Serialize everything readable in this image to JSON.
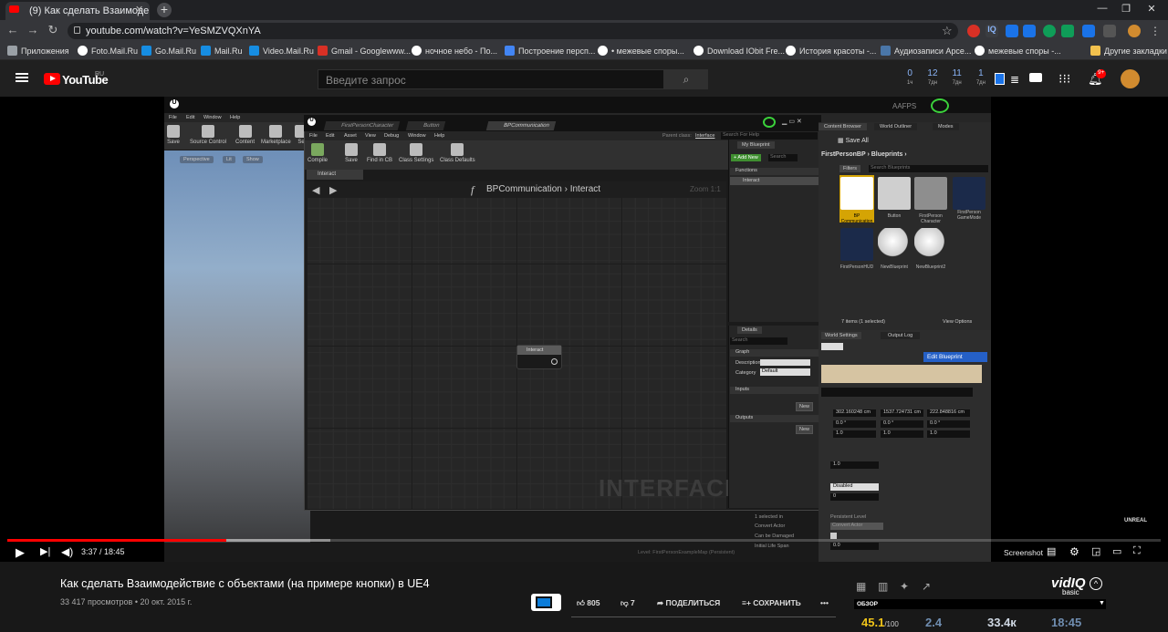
{
  "browser": {
    "tab_title": "(9) Как сделать Взаимодействие",
    "new_tab": "+",
    "url": "youtube.com/watch?v=YeSMZVQXnYA",
    "window_controls": [
      "—",
      "❐",
      "✕"
    ]
  },
  "bookmarks": [
    {
      "label": "Приложения",
      "color": "#9aa0a6"
    },
    {
      "label": "Foto.Mail.Ru",
      "color": "#ffffff"
    },
    {
      "label": "Go.Mail.Ru",
      "color": "#168de2"
    },
    {
      "label": "Mail.Ru",
      "color": "#168de2"
    },
    {
      "label": "Video.Mail.Ru",
      "color": "#168de2"
    },
    {
      "label": "Gmail - Googlewww...",
      "color": "#d93025"
    },
    {
      "label": "ночное небо - По...",
      "color": "#ffffff"
    },
    {
      "label": "Построение персп...",
      "color": "#4285f4"
    },
    {
      "label": "• межевые споры...",
      "color": "#ffffff"
    },
    {
      "label": "Download IObit Fre...",
      "color": "#ffffff"
    },
    {
      "label": "История красоты -...",
      "color": "#ffffff"
    },
    {
      "label": "Аудиозаписи Арсе...",
      "color": "#4a76a8"
    },
    {
      "label": "межевые споры -...",
      "color": "#ffffff"
    }
  ],
  "bookmarks_other": "Другие закладки",
  "youtube": {
    "logo_text": "YouTube",
    "region": "RU",
    "search_placeholder": "Введите запрос",
    "notifications_badge": "9+",
    "vidiq_counters": [
      {
        "value": "0",
        "label": "1ч"
      },
      {
        "value": "12",
        "label": "7дн"
      },
      {
        "value": "11",
        "label": "7дн"
      },
      {
        "value": "1",
        "label": "7дн"
      }
    ]
  },
  "player": {
    "progress": 0.19,
    "buffered": 0.28,
    "time": "3:37 / 18:45",
    "screenshot_label": "Screenshot",
    "unreal_badge": "UNREAL"
  },
  "ue_editor": {
    "main_menu": [
      "File",
      "Edit",
      "Window",
      "Help"
    ],
    "main_toolbar": [
      "Save",
      "Source Control",
      "Content",
      "Marketplace",
      "Se"
    ],
    "viewport_buttons": [
      "Perspective",
      "Lit",
      "Show"
    ],
    "title_project": "AAFPS",
    "search_help": "Search For Help",
    "level_label": "Level: FirstPersonExampleMap (Persistent)",
    "bp_tabs": [
      "FirstPersonCharacter",
      "Button",
      "BPCommunication"
    ],
    "bp_menu": [
      "File",
      "Edit",
      "Asset",
      "View",
      "Debug",
      "Window",
      "Help"
    ],
    "parent_class_label": "Parent class:",
    "parent_class_value": "Interface",
    "bp_toolbar": [
      "Compile",
      "Save",
      "Find in CB",
      "Class Settings",
      "Class Defaults"
    ],
    "graph_tab": "Interact",
    "breadcrumb_root": "BPCommunication",
    "breadcrumb_leaf": "Interact",
    "zoom": "Zoom 1:1",
    "watermark": "INTERFACE",
    "node_title": "Interact",
    "my_blueprint": {
      "title": "My Blueprint",
      "add_new": "+ Add New",
      "search": "Search",
      "functions_header": "Functions",
      "function_item": "Interact"
    },
    "details": {
      "title": "Details",
      "search": "Search",
      "graph_header": "Graph",
      "description_label": "Description",
      "category_label": "Category",
      "category_value": "Default",
      "inputs_header": "Inputs",
      "outputs_header": "Outputs",
      "new_button": "New"
    },
    "content_browser": {
      "tabs": [
        "Content Browser",
        "World Outliner",
        "Modes"
      ],
      "save_all": "Save All",
      "path": [
        "FirstPersonBP",
        "Blueprints"
      ],
      "filters": "Filters",
      "search": "Search Blueprints",
      "assets": [
        {
          "label": "BP Communication",
          "color": "#e8b100"
        },
        {
          "label": "Button",
          "color": "#dddddd"
        },
        {
          "label": "FirstPerson Character",
          "color": "#aaaaaa"
        },
        {
          "label": "FirstPerson GameMode",
          "color": "#1b2a4a"
        },
        {
          "label": "FirstPersonHUD",
          "color": "#1b2a4a"
        },
        {
          "label": "NewBlueprint",
          "color": "#e0e0e0"
        },
        {
          "label": "NewBlueprint2",
          "color": "#e0e0e0"
        }
      ],
      "items_selected": "7 items (1 selected)",
      "view_options": "View Options"
    },
    "lower_right": {
      "tabs": [
        "World Settings",
        "Output Log"
      ],
      "edit_blueprint": "Edit Blueprint",
      "transform_values": [
        "302.160248 cm",
        "1537.724731 cm",
        "222.848816 cm",
        "0.0 °",
        "0.0 °",
        "0.0 °",
        "1.0",
        "1.0",
        "1.0"
      ],
      "field_values": [
        "1.0",
        "Disabled",
        "0"
      ],
      "rows": [
        {
          "label": "1 selected in",
          "value": "Persistent Level"
        },
        {
          "label": "Convert Actor",
          "value": "Convert Actor"
        },
        {
          "label": "Can be Damaged",
          "value": ""
        },
        {
          "label": "Initial Life Span",
          "value": "0.0"
        }
      ]
    }
  },
  "video": {
    "title": "Как сделать Взаимодействие с объектами (на примере кнопки) в UE4",
    "views": "33 417 просмотров",
    "date": "20 окт. 2015 г.",
    "likes": "805",
    "dislikes": "7",
    "share": "ПОДЕЛИТЬСЯ",
    "save": "СОХРАНИТЬ",
    "more": "•••"
  },
  "vidiq": {
    "logo": "vidIQ",
    "tier": "basic",
    "overview_label": "ОБЗОР",
    "score": "45.1",
    "score_max": "/100",
    "stat2": "2.4",
    "stat3": "33.4к",
    "stat4": "18:45"
  }
}
